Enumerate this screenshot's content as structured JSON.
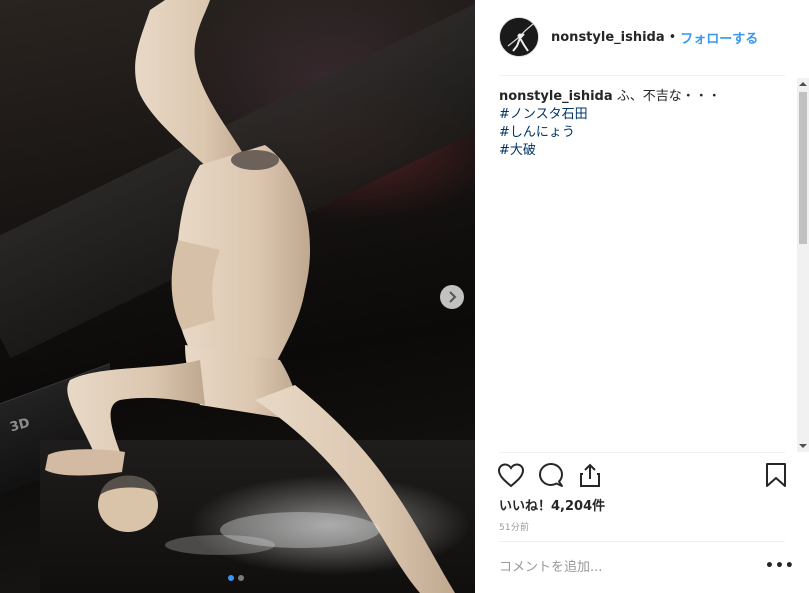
{
  "post": {
    "username": "nonstyle_ishida",
    "separator": "•",
    "follow_label": "フォローする",
    "avatar_icon": "fencer-avatar-icon"
  },
  "caption": {
    "username": "nonstyle_ishida",
    "text": "ふ、不吉な・・・",
    "hashtags": [
      "#ノンスタ石田",
      "#しんにょう",
      "#大破"
    ]
  },
  "photo": {
    "tv_label": "3D",
    "next_icon": "chevron-right-icon",
    "carousel": {
      "count": 2,
      "active_index": 0
    }
  },
  "actions": {
    "like_icon": "heart-icon",
    "comment_icon": "comment-icon",
    "share_icon": "share-icon",
    "save_icon": "bookmark-icon"
  },
  "likes_text": "いいね！4,204件",
  "timestamp": "51分前",
  "comment_box": {
    "placeholder": "コメントを追加...",
    "more_label": "•••"
  },
  "colors": {
    "link_blue": "#3897f0",
    "hashtag": "#003569",
    "text": "#262626",
    "muted": "#999999"
  }
}
